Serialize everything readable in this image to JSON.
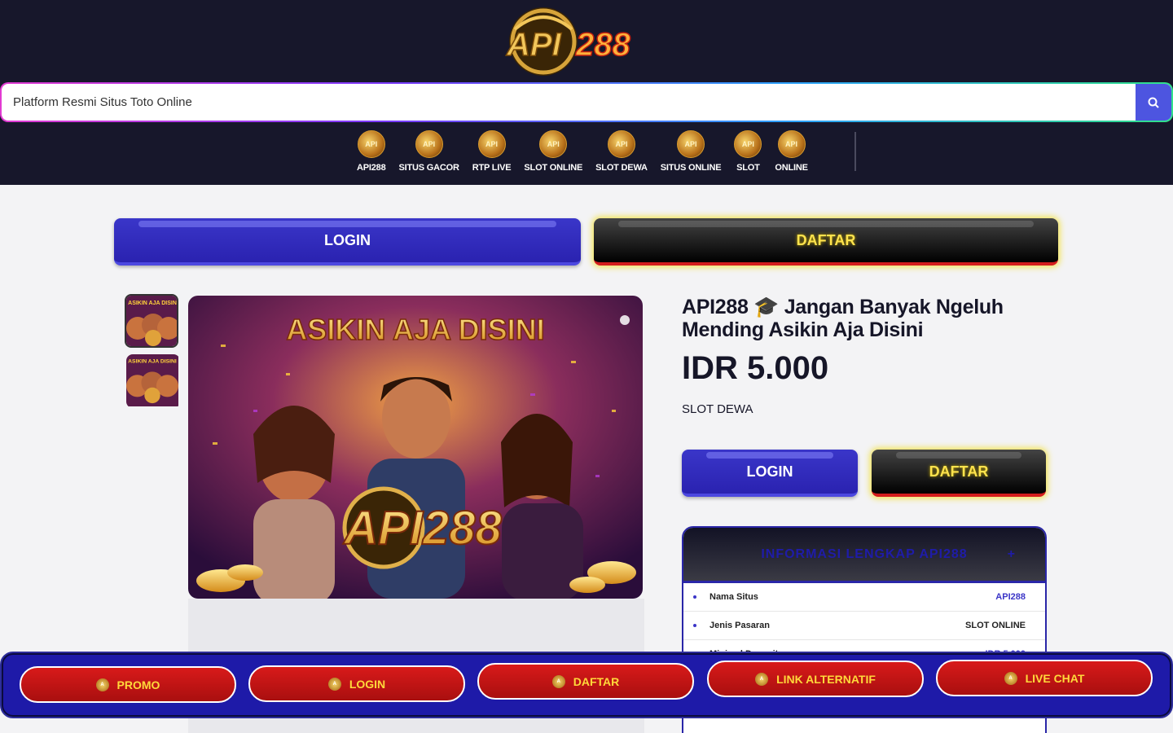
{
  "header": {
    "logo_text": "API288",
    "search_placeholder": "Platform Resmi Situs Toto Online",
    "nav": [
      {
        "label": "API288"
      },
      {
        "label": "SITUS GACOR"
      },
      {
        "label": "RTP LIVE"
      },
      {
        "label": "SLOT ONLINE"
      },
      {
        "label": "SLOT DEWA"
      },
      {
        "label": "SITUS ONLINE"
      },
      {
        "label": "SLOT"
      },
      {
        "label": "ONLINE"
      }
    ]
  },
  "top_buttons": {
    "login": "LOGIN",
    "daftar": "DAFTAR"
  },
  "gallery": {
    "banner_text": "ASIKIN AJA DISINI",
    "banner_logo": "API288",
    "thumb_text": "ASIKIN AJA DISINI"
  },
  "product": {
    "title": "API288 🎓 Jangan Banyak Ngeluh Mending Asikin Aja Disini",
    "price": "IDR 5.000",
    "category": "SLOT DEWA",
    "login": "LOGIN",
    "daftar": "DAFTAR"
  },
  "info_card": {
    "heading": "INFORMASI LENGKAP API288",
    "toggle": "+",
    "rows": [
      {
        "key": "Nama Situs",
        "value": "API288"
      },
      {
        "key": "Jenis Pasaran",
        "value": "SLOT ONLINE"
      },
      {
        "key": "Minimal Deposit",
        "value": "IDR 5.000"
      }
    ]
  },
  "bottom_bar": [
    {
      "label": "PROMO"
    },
    {
      "label": "LOGIN"
    },
    {
      "label": "DAFTAR"
    },
    {
      "label": "LINK ALTERNATIF"
    },
    {
      "label": "LIVE CHAT"
    }
  ],
  "colors": {
    "accent": "#2a22b0",
    "header_bg": "#17172b",
    "cta_red": "#d81a1a",
    "cta_yellow": "#ffe34d"
  }
}
